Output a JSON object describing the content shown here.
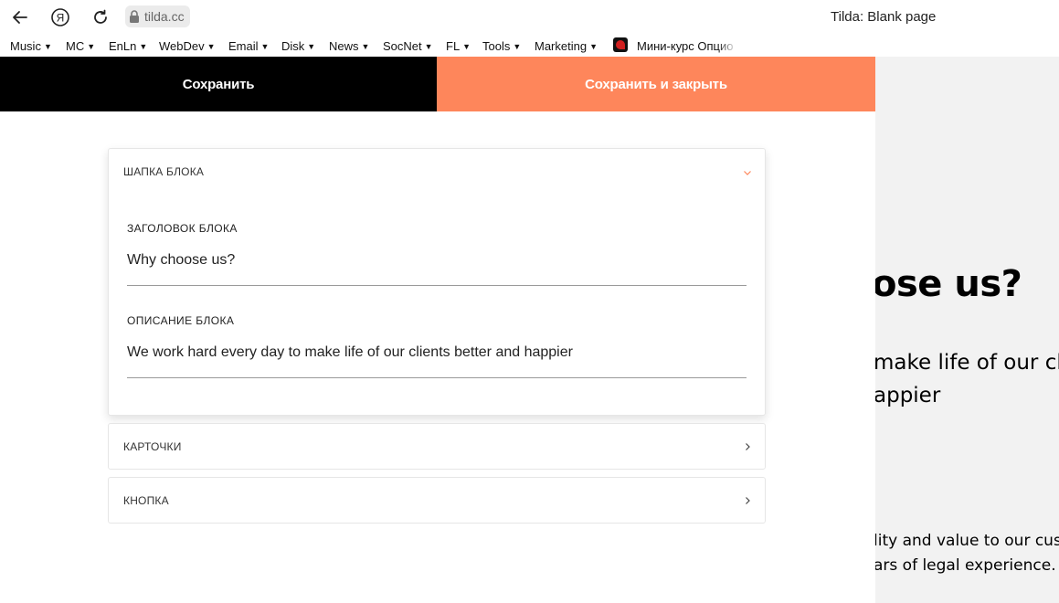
{
  "browser": {
    "url": "tilda.cc",
    "window_title": "Tilda: Blank page",
    "bookmarks": [
      {
        "label": "Music"
      },
      {
        "label": "MC"
      },
      {
        "label": "EnLn"
      },
      {
        "label": "WebDev"
      },
      {
        "label": "Email"
      },
      {
        "label": "Disk"
      },
      {
        "label": "News"
      },
      {
        "label": "SocNet"
      },
      {
        "label": "FL"
      },
      {
        "label": "Tools"
      },
      {
        "label": "Marketing"
      }
    ],
    "bookmark_course": "Мини-курс Опцио",
    "dropdown_arrow": "▼"
  },
  "toolbar": {
    "save_label": "Сохранить",
    "save_close_label": "Сохранить и закрыть"
  },
  "sections": {
    "header": {
      "title": "ШАПКА БЛОКА",
      "fields": [
        {
          "label": "ЗАГОЛОВОК БЛОКА",
          "value": "Why choose us?"
        },
        {
          "label": "ОПИСАНИЕ БЛОКА",
          "value": "We work hard every day to make life of our clients better and happier"
        }
      ]
    },
    "cards": {
      "title": "КАРТОЧКИ"
    },
    "button": {
      "title": "КНОПКА"
    }
  },
  "preview": {
    "title_visible": "ose us?",
    "desc_line1": "make life of our cli",
    "desc_line2": "appier",
    "text_line1": "lity and value to our cus",
    "text_line2": "ars of legal experience."
  },
  "colors": {
    "accent": "#fe865b",
    "save_bg": "#000000",
    "preview_bg": "#f2f2f2"
  }
}
